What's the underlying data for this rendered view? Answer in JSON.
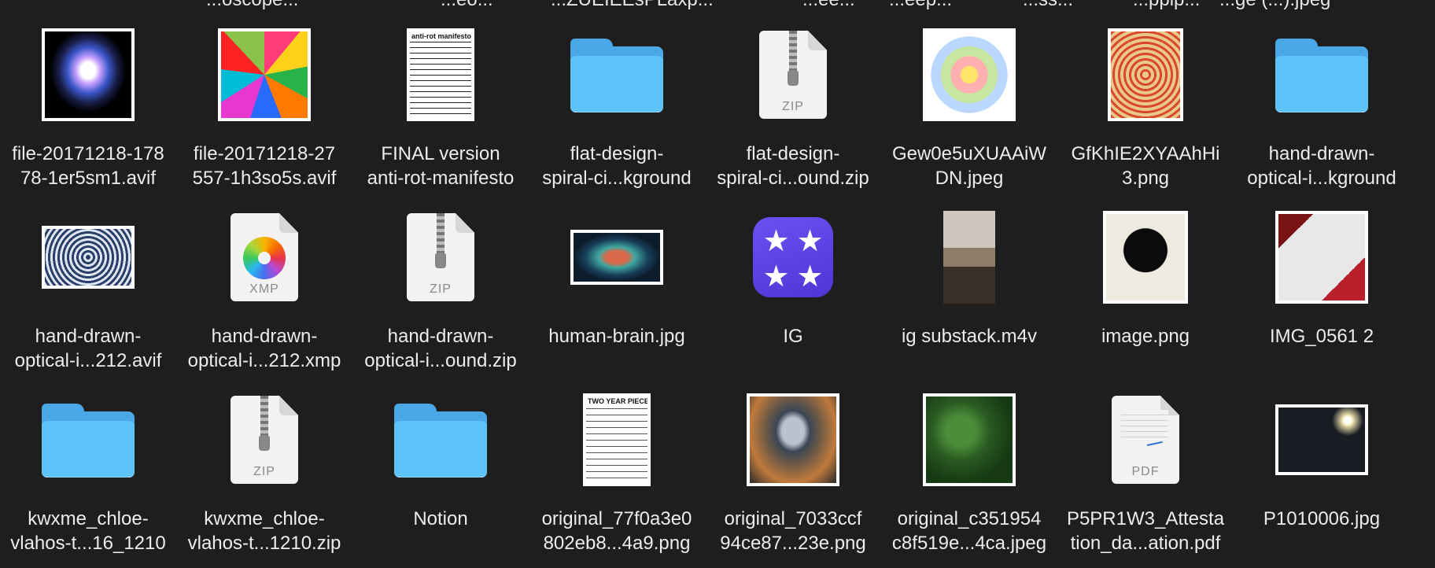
{
  "top_partial_labels": [
    "...oscope...",
    "...eo...",
    "...ZUEIEEsPLaxp...",
    "...ee...",
    "...eep...",
    "...ss...",
    "...pplp...",
    "...ge (...).jpeg"
  ],
  "colors": {
    "background": "#1e1e1e",
    "folder": "#5ec2fb",
    "ig_app": "#5a43e6"
  },
  "items": [
    {
      "label": "file-20171218-178\n78-1er5sm1.avif",
      "kind": "photo",
      "icon": "brain-scan-thumbnail"
    },
    {
      "label": "file-20171218-27\n557-1h3so5s.avif",
      "kind": "photo",
      "icon": "pop-art-brains-thumbnail"
    },
    {
      "label": "FINAL version\nanti-rot-manifesto",
      "kind": "photo",
      "icon": "manifesto-document-thumbnail",
      "thumb_text": "anti-rot manifesto"
    },
    {
      "label": "flat-design-\nspiral-ci...kground",
      "kind": "folder",
      "icon": "folder-icon"
    },
    {
      "label": "flat-design-\nspiral-ci...ound.zip",
      "kind": "zip",
      "icon": "zip-archive-icon",
      "ext": "ZIP"
    },
    {
      "label": "Gew0e5uXUAAiW\nDN.jpeg",
      "kind": "photo",
      "icon": "emotion-wheel-thumbnail"
    },
    {
      "label": "GfKhIE2XYAAhHi\n3.png",
      "kind": "photo",
      "icon": "concentric-squares-thumbnail"
    },
    {
      "label": "hand-drawn-\noptical-i...kground",
      "kind": "folder",
      "icon": "folder-icon"
    },
    {
      "label": "hand-drawn-\noptical-i...212.avif",
      "kind": "photo",
      "icon": "optical-illusion-thumbnail"
    },
    {
      "label": "hand-drawn-\noptical-i...212.xmp",
      "kind": "xmp",
      "icon": "photos-document-icon",
      "ext": "XMP"
    },
    {
      "label": "hand-drawn-\noptical-i...ound.zip",
      "kind": "zip",
      "icon": "zip-archive-icon",
      "ext": "ZIP"
    },
    {
      "label": "human-brain.jpg",
      "kind": "photo",
      "icon": "human-brain-thumbnail"
    },
    {
      "label": "IG",
      "kind": "app",
      "icon": "ig-app-icon"
    },
    {
      "label": "ig substack.m4v",
      "kind": "photo",
      "icon": "video-thumbnail"
    },
    {
      "label": "image.png",
      "kind": "photo",
      "icon": "poster-thumbnail"
    },
    {
      "label": "IMG_0561 2",
      "kind": "photo",
      "icon": "book-photo-thumbnail"
    },
    {
      "label": "kwxme_chloe-\nvlahos-t...16_1210",
      "kind": "folder",
      "icon": "folder-icon"
    },
    {
      "label": "kwxme_chloe-\nvlahos-t...1210.zip",
      "kind": "zip",
      "icon": "zip-archive-icon",
      "ext": "ZIP"
    },
    {
      "label": "Notion",
      "kind": "folder",
      "icon": "folder-icon"
    },
    {
      "label": "original_77f0a3e0\n802eb8...4a9.png",
      "kind": "photo",
      "icon": "text-page-thumbnail",
      "thumb_text": "TWO YEAR PIECE"
    },
    {
      "label": "original_7033ccf\n94ce87...23e.png",
      "kind": "photo",
      "icon": "astronaut-thumbnail"
    },
    {
      "label": "original_c351954\nc8f519e...4ca.jpeg",
      "kind": "photo",
      "icon": "forest-thumbnail"
    },
    {
      "label": "P5PR1W3_Attesta\ntion_da...ation.pdf",
      "kind": "pdf",
      "icon": "pdf-document-icon",
      "ext": "PDF"
    },
    {
      "label": "P1010006.jpg",
      "kind": "photo",
      "icon": "night-city-thumbnail"
    }
  ]
}
